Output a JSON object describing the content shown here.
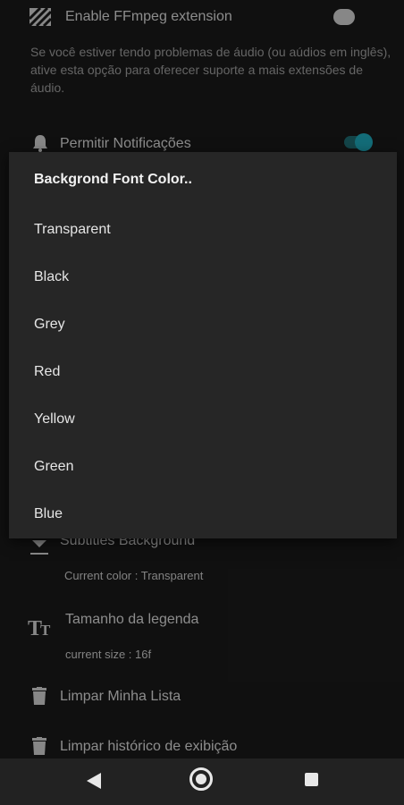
{
  "settings": {
    "ffmpeg": {
      "title": "Enable FFmpeg extension",
      "description": "Se você estiver tendo problemas de áudio (ou aúdios em inglês), ative esta opção para oferecer suporte a mais extensões de áudio.",
      "enabled": false
    },
    "notifications": {
      "title": "Permitir Notificações",
      "enabled": true
    },
    "subtitles_background": {
      "title": "Subtitles Background",
      "subtitle": "Current color : Transparent"
    },
    "subtitle_size": {
      "title": "Tamanho da legenda",
      "subtitle": "current size : 16f"
    },
    "clear_list": {
      "title": "Limpar Minha Lista"
    },
    "clear_history": {
      "title": "Limpar histórico de exibição"
    }
  },
  "dialog": {
    "title": "Backgrond Font Color..",
    "options": [
      "Transparent",
      "Black",
      "Grey",
      "Red",
      "Yellow",
      "Green",
      "Blue"
    ]
  },
  "navbar": {
    "icons": [
      "back-icon",
      "home-icon",
      "recents-icon"
    ]
  },
  "colors": {
    "accent": "#1ea7b8",
    "dialog_bg": "#262626",
    "background": "#1a1a1a"
  }
}
